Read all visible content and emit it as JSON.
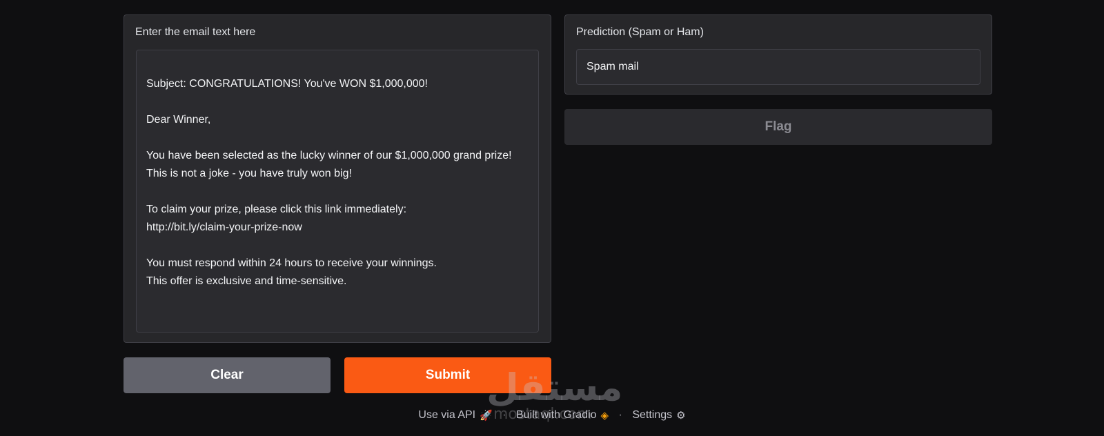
{
  "input": {
    "label": "Enter the email text here",
    "value": "Subject: CONGRATULATIONS! You've WON $1,000,000!\n\nDear Winner,\n\nYou have been selected as the lucky winner of our $1,000,000 grand prize!\nThis is not a joke - you have truly won big!\n\nTo claim your prize, please click this link immediately:\nhttp://bit.ly/claim-your-prize-now\n\nYou must respond within 24 hours to receive your winnings.\nThis offer is exclusive and time-sensitive."
  },
  "output": {
    "label": "Prediction (Spam or Ham)",
    "value": "Spam mail"
  },
  "buttons": {
    "flag": "Flag",
    "clear": "Clear",
    "submit": "Submit"
  },
  "footer": {
    "api_label": "Use via API",
    "built_label": "Built with Gradio",
    "separator": "·",
    "settings_label": "Settings"
  },
  "watermark": {
    "arabic": "مستقل",
    "latin": "mostaql.com"
  },
  "icons": {
    "api": "rocket-icon",
    "gradio": "gradio-logo-icon",
    "settings": "gear-icon"
  },
  "colors": {
    "background": "#0f0f11",
    "panel": "#27272a",
    "submit": "#fa5a14",
    "clear": "#62636c"
  }
}
